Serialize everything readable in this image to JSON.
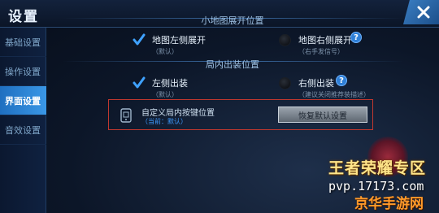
{
  "window": {
    "title": "设置"
  },
  "sidebar": {
    "items": [
      {
        "label": "基础设置",
        "active": false
      },
      {
        "label": "操作设置",
        "active": false
      },
      {
        "label": "界面设置",
        "active": true
      },
      {
        "label": "音效设置",
        "active": false
      }
    ]
  },
  "minimap": {
    "header": "小地图展开位置",
    "left": {
      "label": "地图左侧展开",
      "sub": "（默认）",
      "checked": true
    },
    "right": {
      "label": "地图右侧展开",
      "sub": "（右手发信号）",
      "checked": false
    }
  },
  "shop": {
    "header": "局内出装位置",
    "left": {
      "label": "左侧出装",
      "sub": "（默认）",
      "checked": true
    },
    "right": {
      "label": "右侧出装",
      "sub": "（建议关闭推荐装描述）",
      "checked": false
    }
  },
  "custom": {
    "label": "自定义局内按键位置",
    "sub": "（当前：默认）",
    "reset_label": "恢复默认设置"
  },
  "watermark": {
    "title": "王者荣耀专区",
    "url": "pvp.17173.com",
    "site": "京华手游网"
  },
  "colors": {
    "accent": "#3a97e6",
    "highlight_border": "#c0382f"
  }
}
